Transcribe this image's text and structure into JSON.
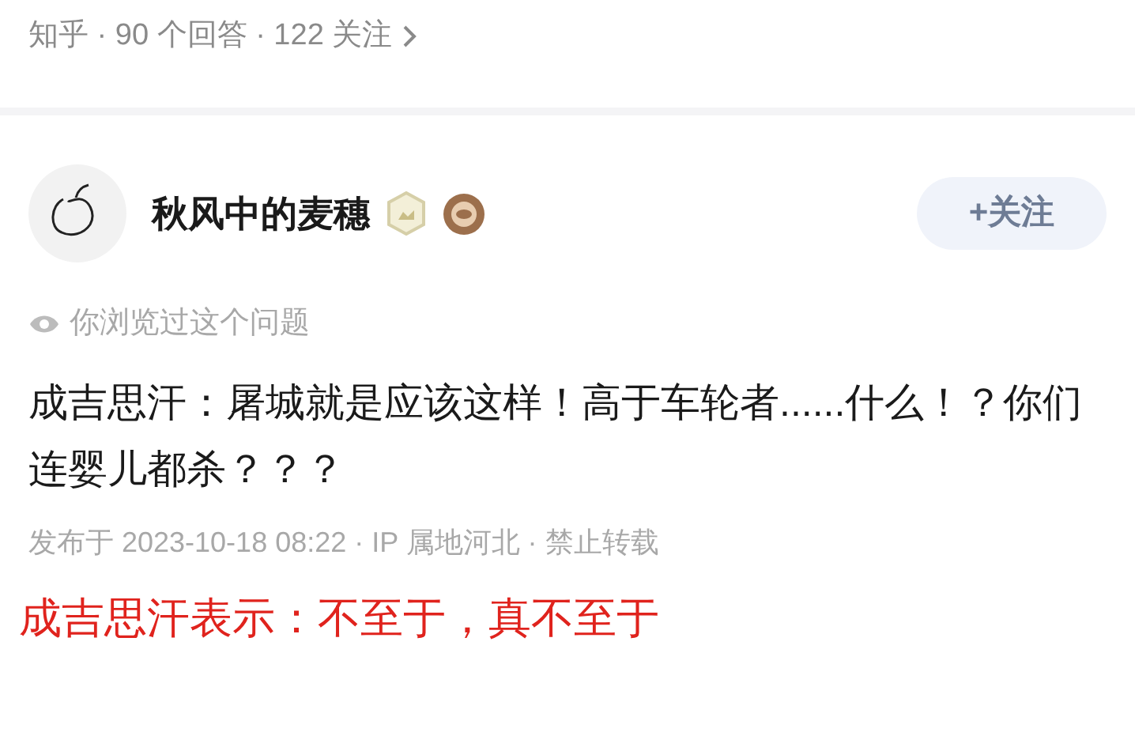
{
  "question_meta": "知乎 · 90 个回答 · 122 关注",
  "author": {
    "name": "秋风中的麦穗",
    "follow_button": "+关注"
  },
  "viewed_note": "你浏览过这个问题",
  "answer_text": "成吉思汗：屠城就是应该这样！高于车轮者......什么！？你们连婴儿都杀？？？",
  "answer_meta": "发布于 2023-10-18 08:22 · IP 属地河北 · 禁止转载",
  "caption": "成吉思汗表示：不至于，真不至于"
}
